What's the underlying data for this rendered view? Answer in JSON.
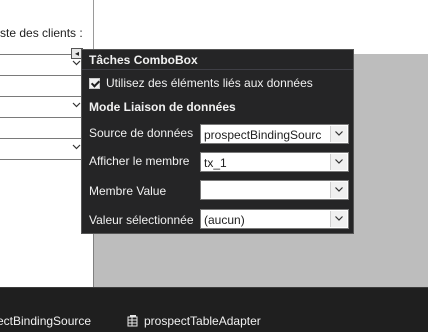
{
  "form": {
    "label_fragment": "ste des clients :"
  },
  "smart_tag": {
    "glyph": "◂"
  },
  "task_panel": {
    "title": "Tâches ComboBox",
    "use_data_bound_label": "Utilisez des éléments liés aux données",
    "use_data_bound_checked": true,
    "section_title": "Mode Liaison de données",
    "rows": [
      {
        "label": "Source de données",
        "value": "prospectBindingSourc"
      },
      {
        "label": "Afficher le membre",
        "value": "tx_1"
      },
      {
        "label": "Membre Value",
        "value": ""
      },
      {
        "label": "Valeur sélectionnée",
        "value": "(aucun)"
      }
    ]
  },
  "tray": {
    "items": [
      {
        "label": "ectBindingSource"
      },
      {
        "label": "prospectTableAdapter",
        "icon": "table-adapter-icon"
      }
    ]
  },
  "colors": {
    "panel_bg": "#252526",
    "tray_bg": "#1f1f1f",
    "grid_bg": "#bdbdbd"
  }
}
